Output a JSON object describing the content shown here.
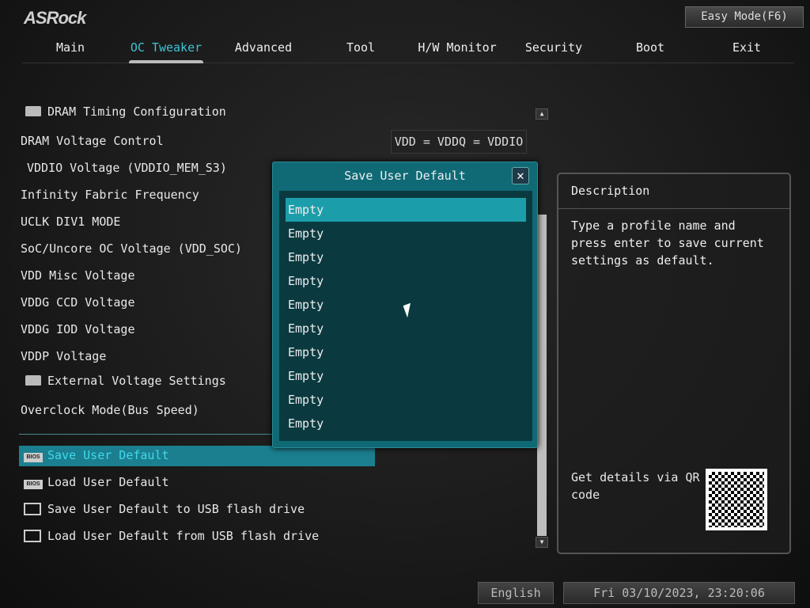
{
  "header": {
    "logo": "ASRock",
    "easy_mode": "Easy Mode(F6)"
  },
  "tabs": [
    "Main",
    "OC Tweaker",
    "Advanced",
    "Tool",
    "H/W Monitor",
    "Security",
    "Boot",
    "Exit"
  ],
  "active_tab": "OC Tweaker",
  "settings": [
    {
      "label": "DRAM Timing Configuration",
      "type": "folder"
    },
    {
      "label": "DRAM Voltage Control",
      "value": "VDD = VDDQ = VDDIO"
    },
    {
      "label": "VDDIO Voltage (VDDIO_MEM_S3)"
    },
    {
      "label": "Infinity Fabric Frequency"
    },
    {
      "label": "UCLK DIV1 MODE"
    },
    {
      "label": "SoC/Uncore OC Voltage (VDD_SOC)"
    },
    {
      "label": "VDD Misc Voltage"
    },
    {
      "label": "VDDG CCD Voltage"
    },
    {
      "label": "VDDG IOD Voltage"
    },
    {
      "label": "VDDP Voltage"
    },
    {
      "label": "External Voltage Settings",
      "type": "folder"
    },
    {
      "label": "Overclock Mode(Bus Speed)"
    }
  ],
  "profile_items": [
    {
      "label": "Save User Default",
      "icon": "bios-icon"
    },
    {
      "label": "Load User Default",
      "icon": "bios-icon"
    },
    {
      "label": "Save User Default to USB flash drive",
      "icon": "floppy-icon"
    },
    {
      "label": "Load User Default from USB flash drive",
      "icon": "floppy-icon"
    }
  ],
  "dialog": {
    "title": "Save User Default",
    "close": "✕",
    "items": [
      "Empty",
      "Empty",
      "Empty",
      "Empty",
      "Empty",
      "Empty",
      "Empty",
      "Empty",
      "Empty",
      "Empty"
    ]
  },
  "description": {
    "title": "Description",
    "text": "Type a profile name and press enter to save current settings as default.",
    "qr_text": "Get details via QR code"
  },
  "footer": {
    "language": "English",
    "datetime": "Fri 03/10/2023, 23:20:06"
  },
  "colors": {
    "accent": "#3cc4d6",
    "selection": "#1b7f90",
    "dialog": "#0f6a76"
  }
}
